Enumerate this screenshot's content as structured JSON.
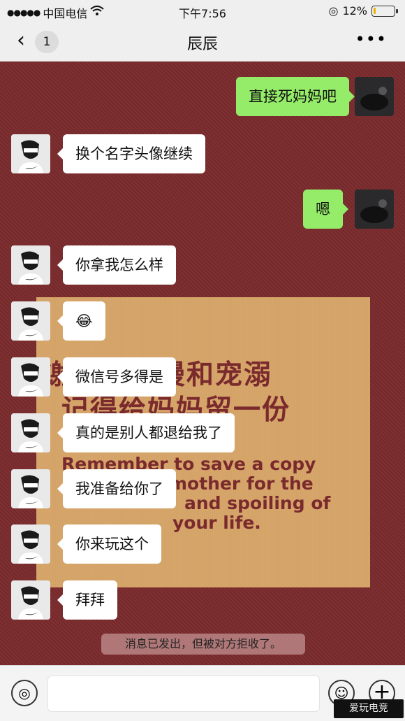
{
  "status_bar": {
    "carrier": "中国电信",
    "time": "下午7:56",
    "battery": "12%",
    "battery_level": 0.12
  },
  "header": {
    "back_badge": "1",
    "title": "辰辰",
    "more": "•••"
  },
  "poster": {
    "cn_line1": "谢谢的浪漫和宠溺",
    "cn_line2": "记得给妈妈留一份",
    "en_line1": "Remember to save a copy",
    "en_line2": "mother for the",
    "en_line3": "and spoiling of",
    "en_line4": "your life."
  },
  "messages": [
    {
      "sender": "me",
      "text": "直接死妈妈吧"
    },
    {
      "sender": "friend",
      "text": "换个名字头像继续"
    },
    {
      "sender": "me",
      "text": "嗯"
    },
    {
      "sender": "friend",
      "text": "你拿我怎么样"
    },
    {
      "sender": "friend",
      "text": "😂"
    },
    {
      "sender": "friend",
      "text": "微信号多得是"
    },
    {
      "sender": "friend",
      "text": "真的是别人都退给我了"
    },
    {
      "sender": "friend",
      "text": "我准备给你了"
    },
    {
      "sender": "friend",
      "text": "你来玩这个"
    },
    {
      "sender": "friend",
      "text": "拜拜"
    }
  ],
  "system_notice": "消息已发出，但被对方拒收了。",
  "input": {
    "placeholder": ""
  },
  "icons": {
    "back": "chevron-left-icon",
    "more": "more-icon",
    "voice": "voice-icon",
    "emoji": "emoji-icon",
    "plus": "plus-icon"
  },
  "watermark": "爱玩电竞"
}
